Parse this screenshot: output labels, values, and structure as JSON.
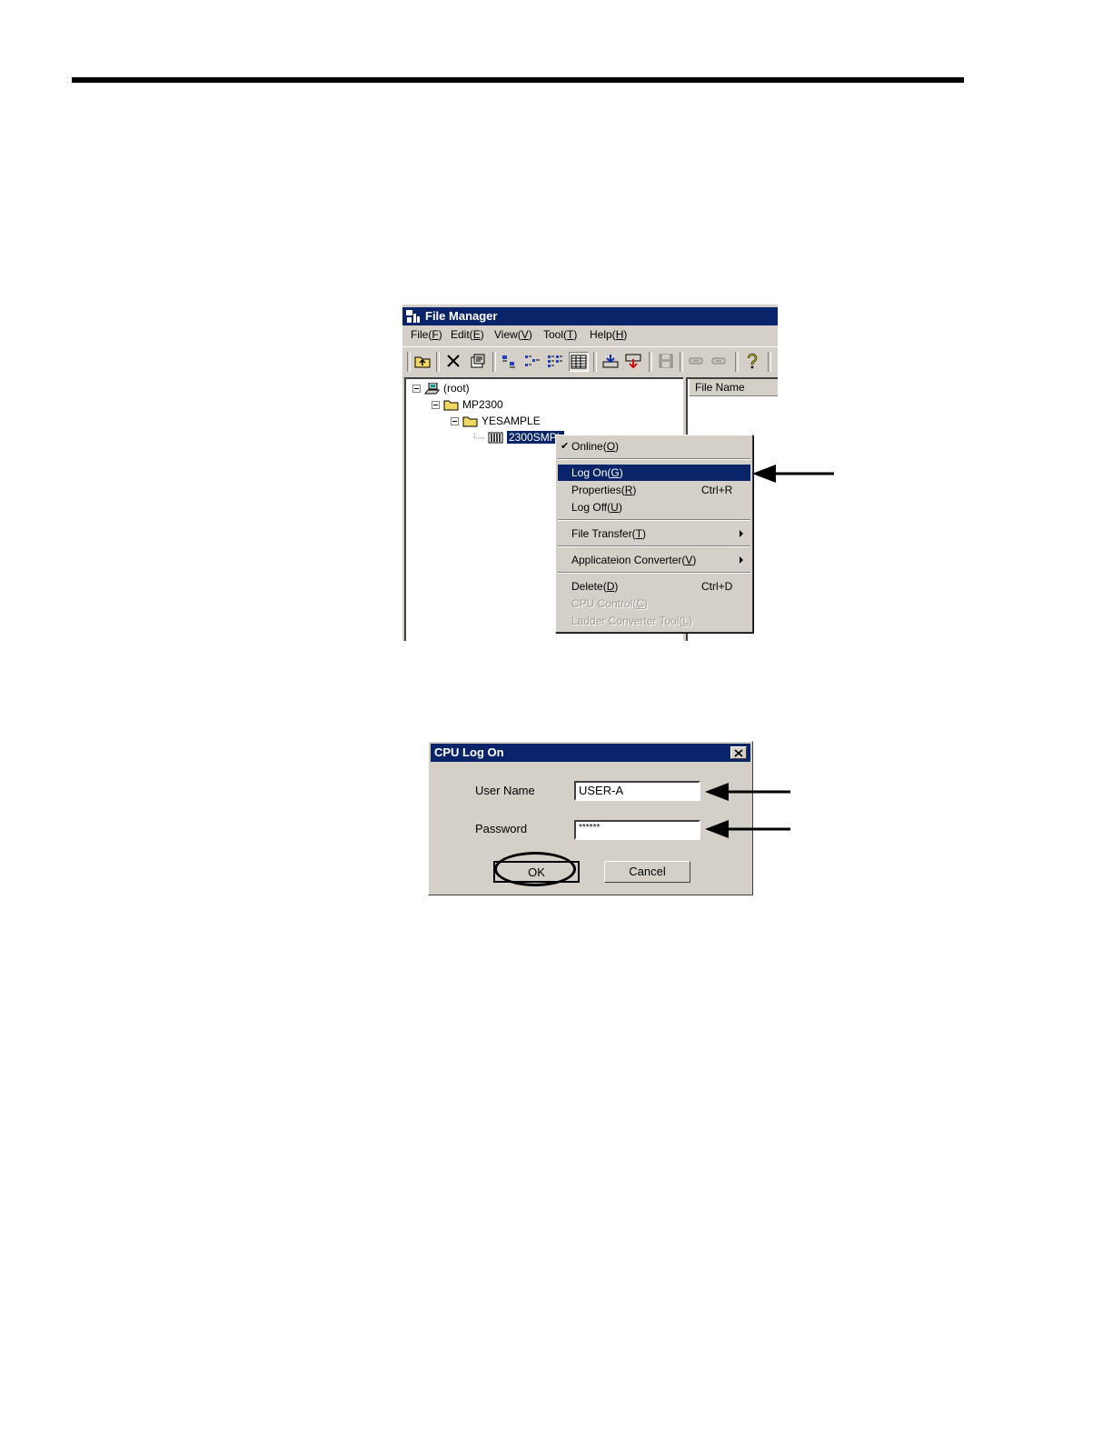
{
  "file_manager": {
    "title": "File Manager",
    "menu": [
      {
        "label": "File(",
        "key": "F",
        "end": ")"
      },
      {
        "label": "Edit(",
        "key": "E",
        "end": ")"
      },
      {
        "label": "View(",
        "key": "V",
        "end": ")"
      },
      {
        "label": "Tool(",
        "key": "T",
        "end": ")"
      },
      {
        "label": "Help(",
        "key": "H",
        "end": ")"
      }
    ],
    "tree": {
      "root": "(root)",
      "project": "MP2300",
      "folder": "YESAMPLE",
      "selected": "2300SMPL"
    },
    "column_header": "File Name"
  },
  "context_menu": {
    "items": {
      "online": {
        "label": "Online(",
        "key": "O",
        "end": ")"
      },
      "logon": {
        "label": "Log On(",
        "key": "G",
        "end": ")"
      },
      "properties": {
        "label": "Properties(",
        "key": "R",
        "end": ")",
        "shortcut": "Ctrl+R"
      },
      "logoff": {
        "label": "Log Off(",
        "key": "U",
        "end": ")"
      },
      "file_transfer": {
        "label": "File Transfer(",
        "key": "T",
        "end": ")"
      },
      "app_converter": {
        "label": "Applicateion Converter(",
        "key": "V",
        "end": ")"
      },
      "delete": {
        "label": "Delete(",
        "key": "D",
        "end": ")",
        "shortcut": "Ctrl+D"
      },
      "cpu_control": {
        "label": "CPU Control(",
        "key": "C",
        "end": ")"
      },
      "ladder": {
        "label": "Ladder Converter Tool(",
        "key": "L",
        "end": ")"
      }
    }
  },
  "logon_dialog": {
    "title": "CPU Log On",
    "user_name_label": "User Name",
    "user_name_value": "USER-A",
    "password_label": "Password",
    "password_value": "******",
    "ok_label": "OK",
    "cancel_label": "Cancel"
  },
  "colors": {
    "titlebar": "#0a246a",
    "face": "#d4d0c8"
  }
}
